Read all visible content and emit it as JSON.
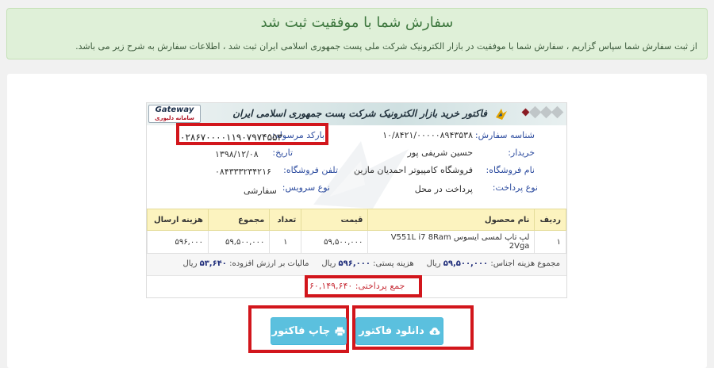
{
  "alert": {
    "title": "سفارش شما با موفقیت ثبت شد",
    "text": "از ثبت سفارش شما سپاس گزاریم ، سفارش شما با موفقیت در بازار الکترونیک شرکت ملی پست جمهوری اسلامی ایران ثبت شد ، اطلاعات سفارش به شرح زیر می باشد."
  },
  "invoice": {
    "title": "فاکتور خرید بازار الکترونیک شرکت پست جمهوری اسلامی ایران",
    "gateway_logo": "Gateway",
    "gateway_sub": "سامانه دلیوری",
    "fields": {
      "order_id_label": "شناسه سفارش:",
      "order_id": "۱۰/۸۴۲۱/۰۰۰۰۰۸۹۴۳۵۳۸",
      "barcode_label": "بارکد مرسوله:",
      "barcode": "۰۲۸۶۷۰۰۰۰۱۱۹۰۷۹۷۴۵۵۳",
      "buyer_label": "خریدار:",
      "buyer": "حسین شریفی پور",
      "date_label": "تاریخ:",
      "date": "۱۳۹۸/۱۲/۰۸",
      "store_label": "نام فروشگاه:",
      "store": "فروشگاه کامپیوتر احمدیان مازین",
      "store_phone_label": "تلفن فروشگاه:",
      "store_phone": "۰۸۴۳۳۳۲۳۴۲۱۶",
      "payment_label": "نوع پرداخت:",
      "payment": "پرداخت در محل",
      "service_label": "نوع سرویس:",
      "service": "سفارشی"
    },
    "table": {
      "headers": [
        "ردیف",
        "نام محصول",
        "قیمت",
        "تعداد",
        "مجموع",
        "هزینه ارسال"
      ],
      "rows": [
        [
          "۱",
          "لپ تاپ لمسی ایسوس V551L i7 8Ram 2Vga",
          "۵۹,۵۰۰,۰۰۰",
          "۱",
          "۵۹,۵۰۰,۰۰۰",
          "۵۹۶,۰۰۰"
        ]
      ]
    },
    "summary": {
      "goods_label": "مجموع هزینه اجناس:",
      "goods_value": "۵۹,۵۰۰,۰۰۰",
      "rial": "ریال",
      "postal_label": "هزینه پستی:",
      "postal_value": "۵۹۶,۰۰۰",
      "vat_label": "مالیات بر ارزش افزوده:",
      "vat_value": "۵۳,۶۴۰"
    },
    "total_label": "جمع پرداختی:",
    "total_value": "۶۰,۱۴۹,۶۴۰"
  },
  "buttons": {
    "download_label": "دانلود فاکتور",
    "print_label": "چاپ فاکتور"
  },
  "colors": {
    "alert_bg": "#dff0d8",
    "button": "#5bc0de",
    "highlight": "#d2161c",
    "table_header": "#fcf3bf"
  }
}
